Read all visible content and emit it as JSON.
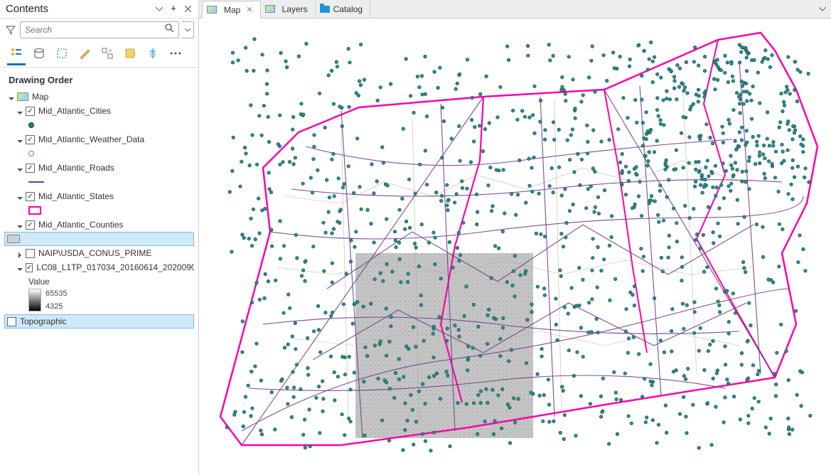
{
  "contents": {
    "title": "Contents",
    "search_placeholder": "Search",
    "section_title": "Drawing Order",
    "map_label": "Map",
    "layers": [
      {
        "name": "Mid_Atlantic_Cities",
        "checked": true,
        "symbol": "teal-point"
      },
      {
        "name": "Mid_Atlantic_Weather_Data",
        "checked": true,
        "symbol": "hollow-point"
      },
      {
        "name": "Mid_Atlantic_Roads",
        "checked": true,
        "symbol": "purple-line"
      },
      {
        "name": "Mid_Atlantic_States",
        "checked": true,
        "symbol": "magenta-box"
      },
      {
        "name": "Mid_Atlantic_Counties",
        "checked": true,
        "symbol": "gray-fill",
        "selected_symbol": true
      },
      {
        "name": "NAIP\\USDA_CONUS_PRIME",
        "checked": false
      },
      {
        "name": "LC08_L1TP_017034_20160614_2020090...",
        " checked": true
      }
    ],
    "value_label": "Value",
    "value_max": "65535",
    "value_min": "4325",
    "topographic": "Topographic"
  },
  "tabs": {
    "map": "Map",
    "layers": "Layers",
    "catalog": "Catalog"
  }
}
